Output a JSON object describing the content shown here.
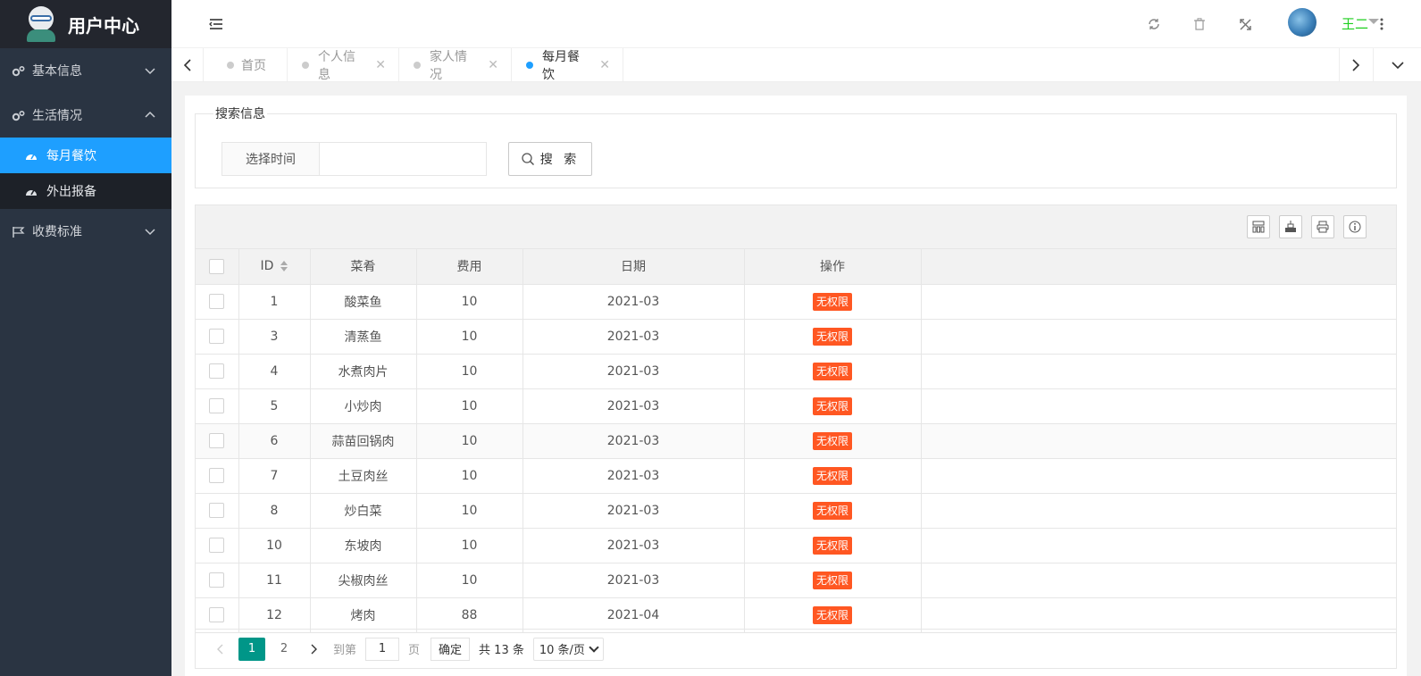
{
  "app": {
    "title": "用户中心"
  },
  "sidebar": {
    "groups": [
      {
        "label": "基本信息",
        "expanded": false
      },
      {
        "label": "生活情况",
        "expanded": true,
        "children": [
          {
            "label": "每月餐饮",
            "active": true
          },
          {
            "label": "外出报备",
            "active": false
          }
        ]
      },
      {
        "label": "收费标准",
        "expanded": false
      }
    ]
  },
  "header": {
    "user_name": "王二"
  },
  "tabs": [
    {
      "label": "首页",
      "closable": false,
      "active": false
    },
    {
      "label": "个人信息",
      "closable": true,
      "active": false
    },
    {
      "label": "家人情况",
      "closable": true,
      "active": false
    },
    {
      "label": "每月餐饮",
      "closable": true,
      "active": true
    }
  ],
  "search": {
    "legend": "搜索信息",
    "field_label": "选择时间",
    "field_value": "",
    "button_label": "搜 索"
  },
  "table": {
    "columns": [
      "ID",
      "菜肴",
      "费用",
      "日期",
      "操作"
    ],
    "rows": [
      {
        "id": "1",
        "dish": "酸菜鱼",
        "cost": "10",
        "date": "2021-03",
        "action": "无权限"
      },
      {
        "id": "3",
        "dish": "清蒸鱼",
        "cost": "10",
        "date": "2021-03",
        "action": "无权限"
      },
      {
        "id": "4",
        "dish": "水煮肉片",
        "cost": "10",
        "date": "2021-03",
        "action": "无权限"
      },
      {
        "id": "5",
        "dish": "小炒肉",
        "cost": "10",
        "date": "2021-03",
        "action": "无权限"
      },
      {
        "id": "6",
        "dish": "蒜苗回锅肉",
        "cost": "10",
        "date": "2021-03",
        "action": "无权限"
      },
      {
        "id": "7",
        "dish": "土豆肉丝",
        "cost": "10",
        "date": "2021-03",
        "action": "无权限"
      },
      {
        "id": "8",
        "dish": "炒白菜",
        "cost": "10",
        "date": "2021-03",
        "action": "无权限"
      },
      {
        "id": "10",
        "dish": "东坡肉",
        "cost": "10",
        "date": "2021-03",
        "action": "无权限"
      },
      {
        "id": "11",
        "dish": "尖椒肉丝",
        "cost": "10",
        "date": "2021-03",
        "action": "无权限"
      },
      {
        "id": "12",
        "dish": "烤肉",
        "cost": "88",
        "date": "2021-04",
        "action": "无权限"
      }
    ]
  },
  "pager": {
    "pages": [
      "1",
      "2"
    ],
    "current": "1",
    "goto_label": "到第",
    "goto_value": "1",
    "page_unit": "页",
    "confirm_label": "确定",
    "total_text": "共 13 条",
    "page_size": "10 条/页"
  },
  "colors": {
    "accent": "#1e9fff",
    "sidebar_bg": "#2a3442",
    "badge": "#ff5722",
    "pager_active": "#009688"
  }
}
